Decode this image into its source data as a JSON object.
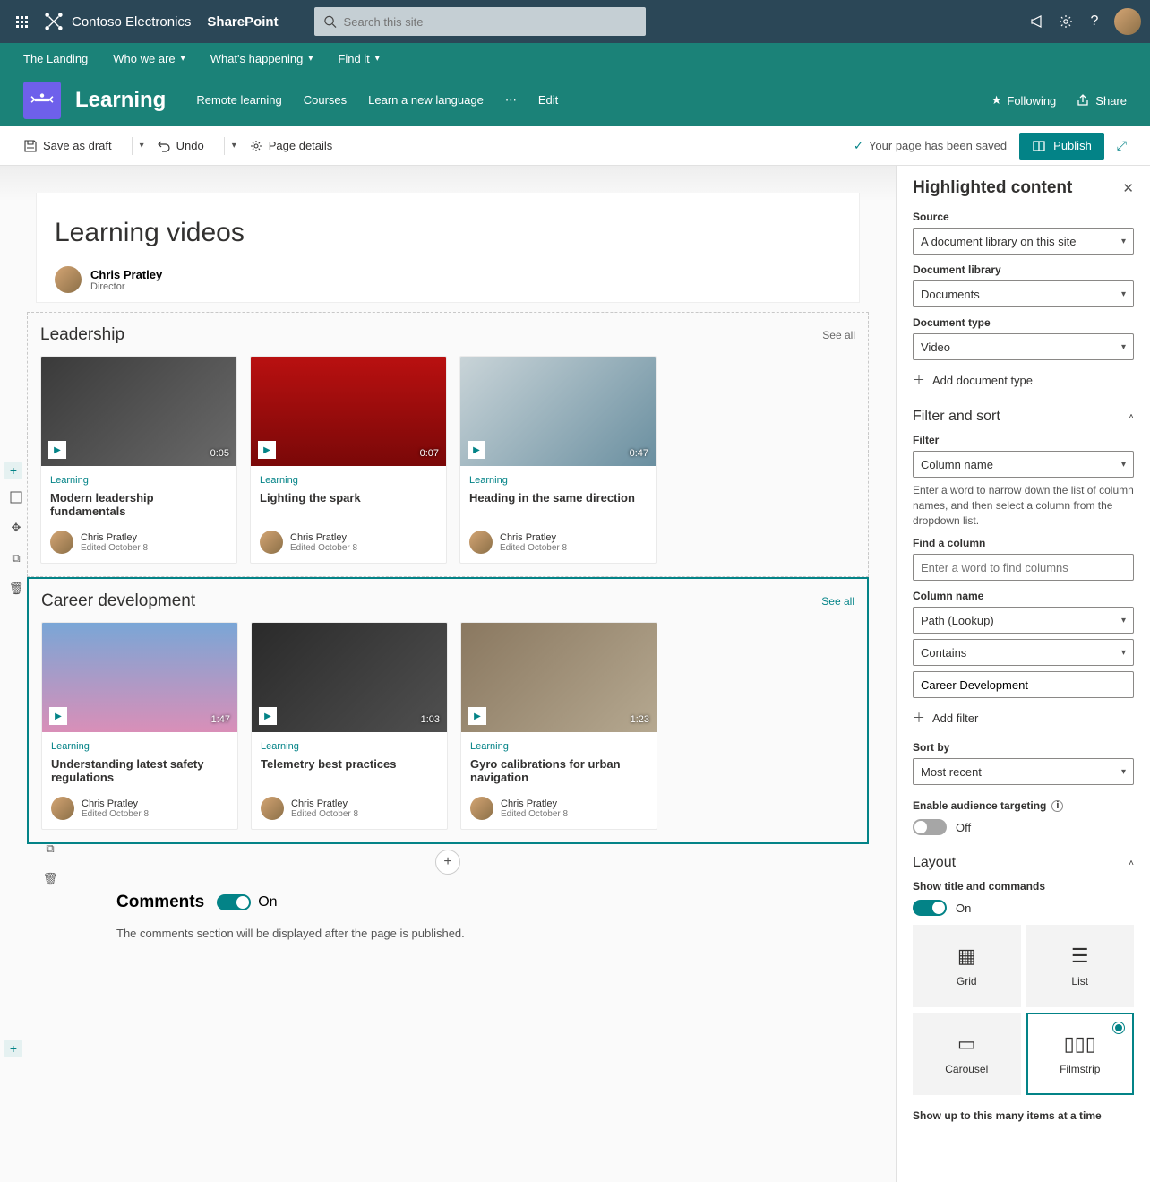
{
  "suite": {
    "brand": "Contoso Electronics",
    "app": "SharePoint",
    "search_placeholder": "Search this site"
  },
  "hub_nav": [
    "The Landing",
    "Who we are",
    "What's happening",
    "Find it"
  ],
  "site": {
    "title": "Learning",
    "nav": [
      "Remote learning",
      "Courses",
      "Learn a new language"
    ],
    "edit": "Edit",
    "following": "Following",
    "share": "Share"
  },
  "command_bar": {
    "save_draft": "Save as draft",
    "undo": "Undo",
    "page_details": "Page details",
    "status": "Your page has been saved",
    "publish": "Publish"
  },
  "page": {
    "title": "Learning videos",
    "author_name": "Chris Pratley",
    "author_role": "Director"
  },
  "sections": [
    {
      "title": "Leadership",
      "see_all": "See all",
      "cards": [
        {
          "site": "Learning",
          "title": "Modern leadership fundamentals",
          "author": "Chris Pratley",
          "date": "Edited October 8",
          "duration": "0:05",
          "thumb": "thumb-a"
        },
        {
          "site": "Learning",
          "title": "Lighting the spark",
          "author": "Chris Pratley",
          "date": "Edited October 8",
          "duration": "0:07",
          "thumb": "thumb-b"
        },
        {
          "site": "Learning",
          "title": "Heading in the same direction",
          "author": "Chris Pratley",
          "date": "Edited October 8",
          "duration": "0:47",
          "thumb": "thumb-c"
        }
      ]
    },
    {
      "title": "Career development",
      "see_all": "See all",
      "cards": [
        {
          "site": "Learning",
          "title": "Understanding latest safety regulations",
          "author": "Chris Pratley",
          "date": "Edited October 8",
          "duration": "1:47",
          "thumb": "thumb-d"
        },
        {
          "site": "Learning",
          "title": "Telemetry best practices",
          "author": "Chris Pratley",
          "date": "Edited October 8",
          "duration": "1:03",
          "thumb": "thumb-e"
        },
        {
          "site": "Learning",
          "title": "Gyro calibrations for urban navigation",
          "author": "Chris Pratley",
          "date": "Edited October 8",
          "duration": "1:23",
          "thumb": "thumb-f"
        }
      ]
    }
  ],
  "comments": {
    "title": "Comments",
    "state": "On",
    "note": "The comments section will be displayed after the page is published."
  },
  "panel": {
    "title": "Highlighted content",
    "source_label": "Source",
    "source_value": "A document library on this site",
    "doclib_label": "Document library",
    "doclib_value": "Documents",
    "doctype_label": "Document type",
    "doctype_value": "Video",
    "add_doctype": "Add document type",
    "filter_sort_title": "Filter and sort",
    "filter_label": "Filter",
    "filter_value": "Column name",
    "filter_hint": "Enter a word to narrow down the list of column names, and then select a column from the dropdown list.",
    "find_col_label": "Find a column",
    "find_col_placeholder": "Enter a word to find columns",
    "colname_label": "Column name",
    "colname_value": "Path (Lookup)",
    "operator_value": "Contains",
    "value_value": "Career Development",
    "add_filter": "Add filter",
    "sortby_label": "Sort by",
    "sortby_value": "Most recent",
    "audience_label": "Enable audience targeting",
    "audience_state": "Off",
    "layout_title": "Layout",
    "show_title_label": "Show title and commands",
    "show_title_state": "On",
    "layout_options": [
      "Grid",
      "List",
      "Carousel",
      "Filmstrip"
    ],
    "limit_label": "Show up to this many items at a time"
  }
}
